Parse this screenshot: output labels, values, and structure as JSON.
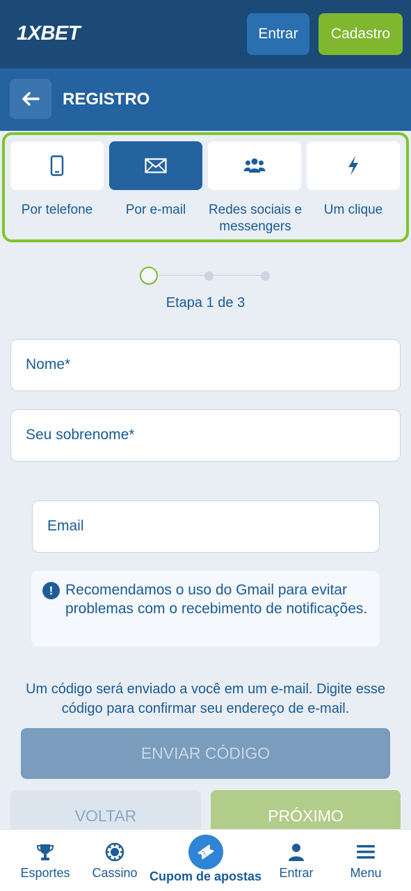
{
  "header": {
    "logo": "1XBET",
    "login_label": "Entrar",
    "register_label": "Cadastro"
  },
  "titlebar": {
    "title": "REGISTRO"
  },
  "methods": [
    {
      "label": "Por telefone",
      "icon": "phone-icon",
      "active": false
    },
    {
      "label": "Por e-mail",
      "icon": "envelope-icon",
      "active": true
    },
    {
      "label": "Redes sociais e messengers",
      "icon": "users-icon",
      "active": false
    },
    {
      "label": "Um clique",
      "icon": "lightning-icon",
      "active": false
    }
  ],
  "stepper": {
    "text": "Etapa 1 de 3",
    "current": 1,
    "total": 3
  },
  "form": {
    "first_name_label": "Nome*",
    "last_name_label": "Seu sobrenome*",
    "email_label": "Email"
  },
  "notice": {
    "text": "Recomendamos o uso do Gmail para evitar problemas com o recebimento de notificações."
  },
  "info": {
    "text": "Um código será enviado a você em um e-mail. Digite esse código para confirmar seu endereço de e-mail."
  },
  "buttons": {
    "send_code": "ENVIAR CÓDIGO",
    "back": "VOLTAR",
    "next": "PRÓXIMO"
  },
  "bottom_nav": {
    "sports": "Esportes",
    "casino": "Cassino",
    "coupon": "Cupom de apostas",
    "login": "Entrar",
    "menu": "Menu"
  },
  "colors": {
    "header_bg": "#1b4a77",
    "titlebar_bg": "#2462a0",
    "accent_green": "#7fb72f",
    "text_blue": "#1a5a94"
  }
}
